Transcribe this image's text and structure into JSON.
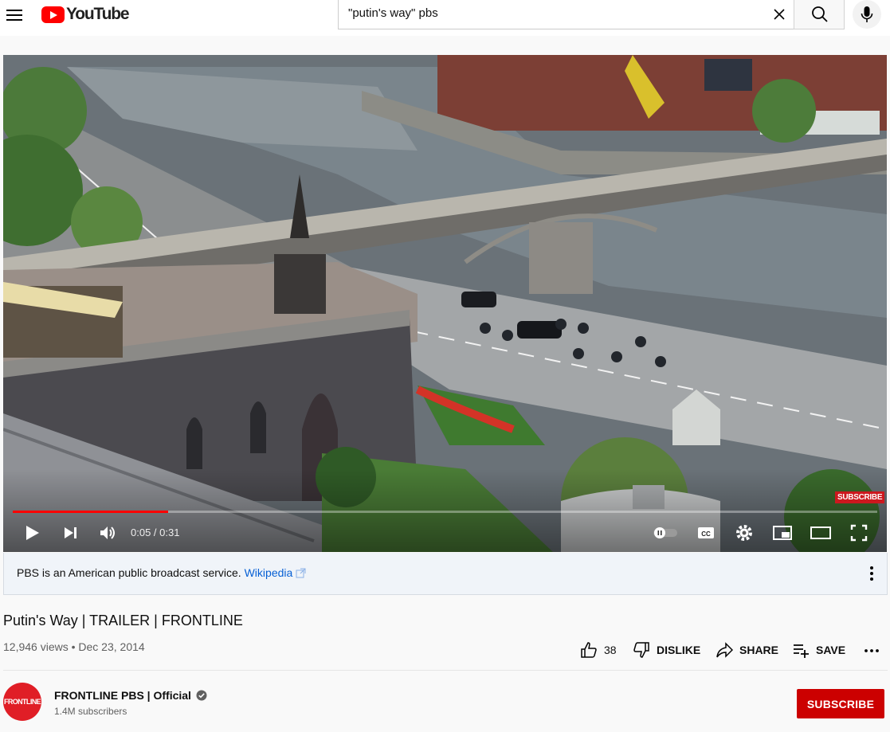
{
  "masthead": {
    "logo_text": "YouTube",
    "search_value": "\"putin's way\" pbs"
  },
  "player": {
    "time_display": "0:05 / 0:31",
    "progress_fraction": 0.18,
    "watermark_label": "SUBSCRIBE"
  },
  "info_panel": {
    "text": "PBS is an American public broadcast service.",
    "link_label": "Wikipedia"
  },
  "video": {
    "title": "Putin's Way | TRAILER | FRONTLINE",
    "views_date": "12,946 views • Dec 23, 2014",
    "like_count": "38",
    "dislike_label": "DISLIKE",
    "share_label": "SHARE",
    "save_label": "SAVE"
  },
  "channel": {
    "avatar_text": "FRONTLINE",
    "name": "FRONTLINE PBS | Official",
    "subscribers": "1.4M subscribers",
    "subscribe_label": "SUBSCRIBE"
  },
  "colors": {
    "accent": "#ff0000",
    "subscribe": "#cc0000",
    "link": "#065fd4"
  }
}
